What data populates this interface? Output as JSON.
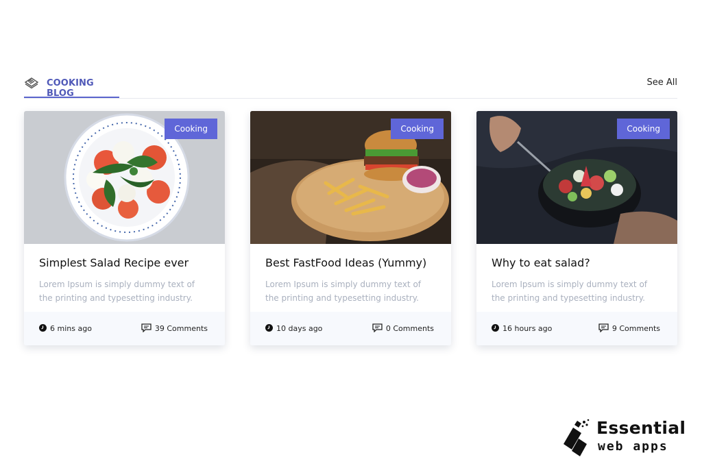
{
  "section": {
    "tab_label": "COOKING BLOG",
    "see_all_label": "See All",
    "icon": "newspaper-icon"
  },
  "colors": {
    "accent": "#5f66d8",
    "tab_text": "#5059b8",
    "excerpt": "#a9b0be",
    "footer_bg": "#f7f9fd"
  },
  "cards": [
    {
      "badge": "Cooking",
      "title": "Simplest Salad Recipe ever",
      "excerpt": "Lorem Ipsum is simply dummy text of the printing and typesetting industry.",
      "time": "6 mins ago",
      "comments": "39 Comments",
      "image": "caprese-salad-plate"
    },
    {
      "badge": "Cooking",
      "title": "Best FastFood Ideas (Yummy)",
      "excerpt": "Lorem Ipsum is simply dummy text of the printing and typesetting industry.",
      "time": "10 days ago",
      "comments": "0 Comments",
      "image": "burger-and-fries"
    },
    {
      "badge": "Cooking",
      "title": "Why to eat salad?",
      "excerpt": "Lorem Ipsum is simply dummy text of the printing and typesetting industry.",
      "time": "16 hours ago",
      "comments": "9 Comments",
      "image": "salad-bowl-hands"
    }
  ],
  "watermark": {
    "line1": "Essential",
    "line2": "web apps"
  }
}
